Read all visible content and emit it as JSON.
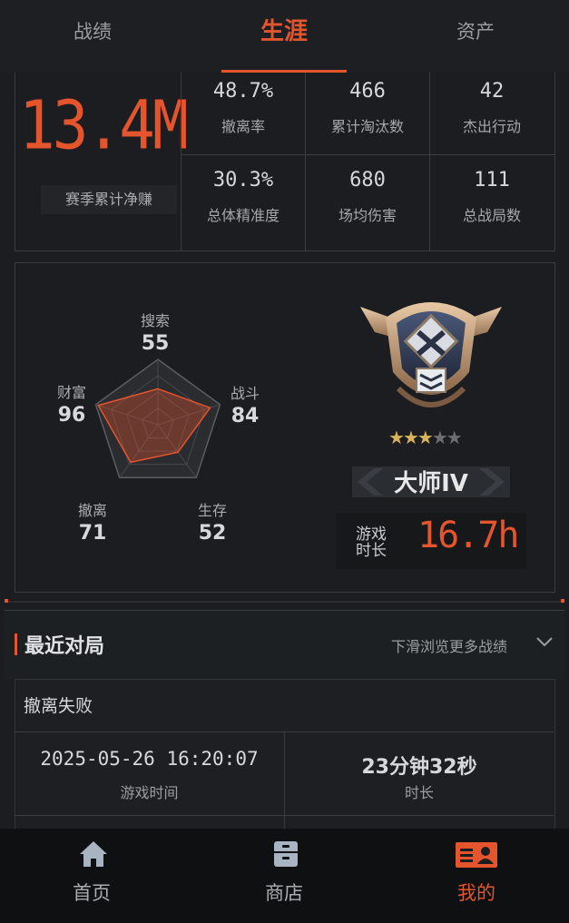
{
  "tabs": [
    {
      "label": "战绩"
    },
    {
      "label": "生涯"
    },
    {
      "label": "资产"
    }
  ],
  "active_tab": 1,
  "summary": {
    "net_earnings_value": "13.4M",
    "net_earnings_label": "赛季累计净赚",
    "stats": [
      {
        "value": "48.7%",
        "label": "撤离率"
      },
      {
        "value": "466",
        "label": "累计淘汰数"
      },
      {
        "value": "42",
        "label": "杰出行动"
      },
      {
        "value": "30.3%",
        "label": "总体精准度"
      },
      {
        "value": "680",
        "label": "场均伤害"
      },
      {
        "value": "111",
        "label": "总战局数"
      }
    ]
  },
  "radar": {
    "axes": [
      {
        "name": "搜索",
        "score": "55",
        "value": 55
      },
      {
        "name": "战斗",
        "score": "84",
        "value": 84
      },
      {
        "name": "生存",
        "score": "52",
        "value": 52
      },
      {
        "name": "撤离",
        "score": "71",
        "value": 71
      },
      {
        "name": "财富",
        "score": "96",
        "value": 96
      }
    ],
    "max": 100,
    "accent": "#e4542d"
  },
  "rank": {
    "name": "大师IV",
    "stars_filled": 3,
    "stars_total": 5,
    "playtime_label_line1": "游戏",
    "playtime_label_line2": "时长",
    "playtime_value": "16.7h",
    "icon": "master-rank-badge-icon"
  },
  "recent": {
    "title": "最近对局",
    "hint": "下滑浏览更多战绩",
    "match": {
      "status": "撤离失败",
      "time_value": "2025-05-26 16:20:07",
      "time_label": "游戏时间",
      "duration_value": "23分钟32秒",
      "duration_label": "时长"
    }
  },
  "bottom_nav": [
    {
      "label": "首页",
      "icon": "home-icon"
    },
    {
      "label": "商店",
      "icon": "store-icon"
    },
    {
      "label": "我的",
      "icon": "profile-card-icon"
    }
  ],
  "colors": {
    "accent": "#e4542d",
    "background": "#1b1d20"
  }
}
